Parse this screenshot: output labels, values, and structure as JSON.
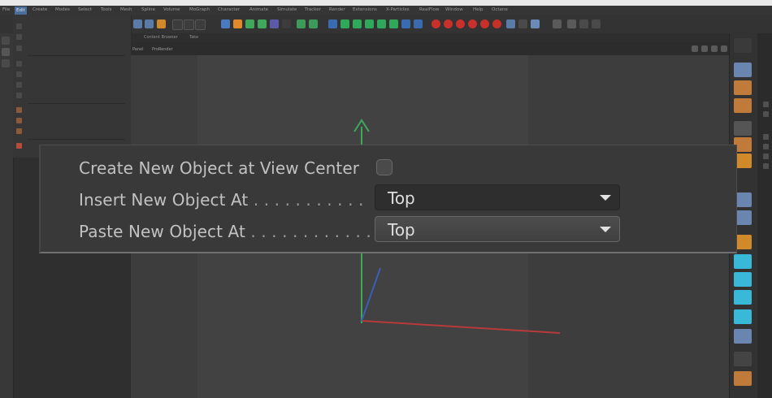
{
  "menubar": {
    "items": [
      "File",
      "Edit",
      "Create",
      "Modes",
      "Select",
      "Tools",
      "Mesh",
      "Spline",
      "Volume",
      "MoGraph",
      "Character",
      "Animate",
      "Simulate",
      "Tracker",
      "Render",
      "Extensions",
      "X-Particles",
      "RealFlow",
      "Window",
      "Help",
      "Octane"
    ],
    "active_index": 1
  },
  "viewport_tabs": [
    "Content Browser",
    "Take"
  ],
  "viewport_header": [
    "Panel",
    "ProRender"
  ],
  "preferences": {
    "create_at_view_center_label": "Create New Object at View Center",
    "insert_label": "Insert New Object At",
    "insert_dots": " . . . . . . . . . . .",
    "insert_value": "Top",
    "paste_label": "Paste New Object At",
    "paste_dots": " . . . . . . . . . . . .",
    "paste_value": "Top",
    "create_at_view_center_checked": false
  },
  "colors": {
    "axis_y": "#3fa85a",
    "axis_x": "#b83a3a",
    "axis_z": "#3a5fb8",
    "menu_highlight": "#4a6e9a"
  }
}
